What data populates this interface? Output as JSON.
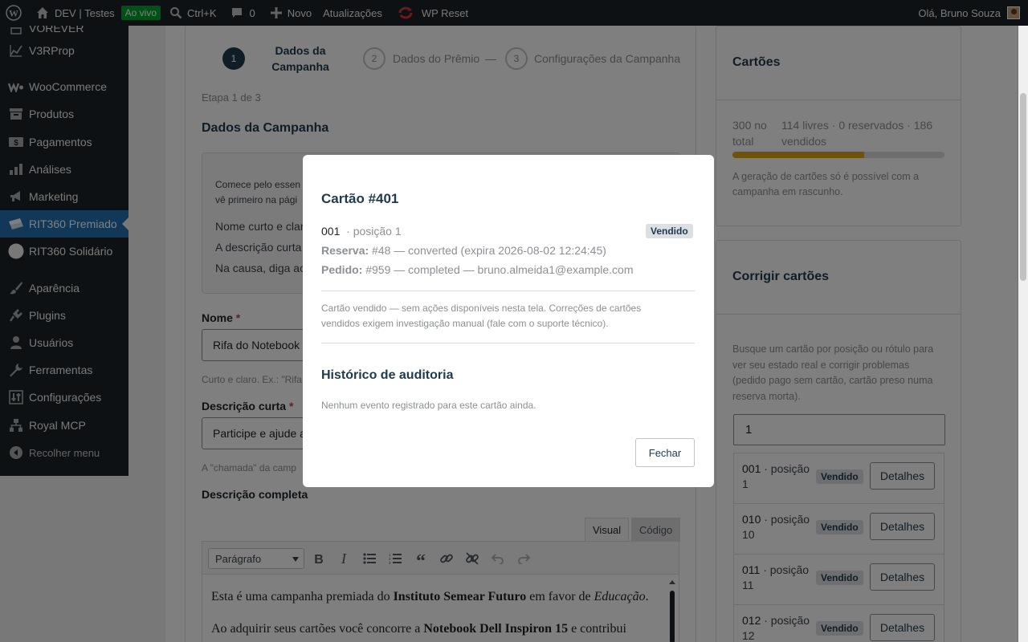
{
  "adminbar": {
    "site": "DEV | Testes",
    "live": "Ao vivo",
    "shortcut": "Ctrl+K",
    "comments": "0",
    "new": "Novo",
    "updates": "Atualizações",
    "reset": "WP Reset",
    "greeting": "Olá, Bruno Souza"
  },
  "sidebar": {
    "partial": "VOREVER",
    "items": [
      "V3RProp",
      "WooCommerce",
      "Produtos",
      "Pagamentos",
      "Análises",
      "Marketing",
      "RIT360 Premiado",
      "RIT360 Solidário",
      "Aparência",
      "Plugins",
      "Usuários",
      "Ferramentas",
      "Configurações",
      "Royal MCP",
      "Recolher menu"
    ]
  },
  "stepper": {
    "s1_num": "1",
    "s1_line1": "Dados da",
    "s1_line2": "Campanha",
    "s2_num": "2",
    "s2_label": "Dados do Prêmio",
    "s3_num": "3",
    "s3_label": "Configurações da Campanha",
    "sep": "—"
  },
  "form": {
    "step": "Etapa 1 de 3",
    "section": "Dados da Campanha",
    "tip": [
      "Comece pelo essen",
      "vê primeiro na pági",
      "Nome curto e clar",
      "A descrição curta",
      "Na causa, diga ao"
    ],
    "name_label": "Nome",
    "required": "*",
    "name_value": "Rifa do Notebook",
    "name_note": "Curto e claro. Ex.: \"Rifa",
    "short_label": "Descrição curta",
    "short_value": "Participe e ajude a",
    "short_note": "A \"chamada\" da camp",
    "full_label": "Descrição completa"
  },
  "editor": {
    "tab_visual": "Visual",
    "tab_code": "Código",
    "format": "Parágrafo",
    "p1_a": "Esta é uma campanha premiada do ",
    "p1_b": "Instituto Semear Futuro",
    "p1_c": " em favor de ",
    "p1_d": "Educação",
    "p1_e": ".",
    "p2_a": "Ao adquirir seus cartões você concorre a ",
    "p2_b": "Notebook Dell Inspiron 15",
    "p2_c": " e contribui"
  },
  "cartoes": {
    "title": "Cartões",
    "total_a": "300 no",
    "total_b": "total",
    "stats_a": "114 livres · 0 reservados · 186",
    "stats_b": "vendidos",
    "sold_fraction": 0.62,
    "note": [
      "A geração de cartões só é possível com a",
      "campanha em rascunho."
    ]
  },
  "corrigir": {
    "title": "Corrigir cartões",
    "desc": [
      "Busque um cartão por posição ou rótulo para",
      "ver seu estado real e corrigir problemas",
      "(pedido pago sem cartão, cartão preso numa",
      "reserva morta)."
    ],
    "search_value": "1",
    "rows": [
      {
        "label": "001",
        "pos_a": " · posição",
        "pos_b": "1",
        "status": "Vendido",
        "action": "Detalhes"
      },
      {
        "label": "010",
        "pos_a": " · posição",
        "pos_b": "10",
        "status": "Vendido",
        "action": "Detalhes"
      },
      {
        "label": "011",
        "pos_a": " · posição",
        "pos_b": "11",
        "status": "Vendido",
        "action": "Detalhes"
      },
      {
        "label": "012",
        "pos_a": " · posição",
        "pos_b": "12",
        "status": "Vendido",
        "action": "Detalhes"
      }
    ]
  },
  "modal": {
    "title": "Cartão #401",
    "label": "001",
    "position": "· posição 1",
    "status": "Vendido",
    "res_label": "Reserva:",
    "res_value": " #48 — converted (expira 2026-08-02 12:24:45)",
    "order_label": "Pedido:",
    "order_value": " #959 — completed — bruno.almeida1@example.com",
    "sold_msg": "Cartão vendido — sem ações disponíveis nesta tela. Correções de cartões vendidos exigem investigação manual (fale com o suporte técnico).",
    "history_title": "Histórico de auditoria",
    "history_empty": "Nenhum evento registrado para este cartão ainda.",
    "close": "Fechar"
  }
}
